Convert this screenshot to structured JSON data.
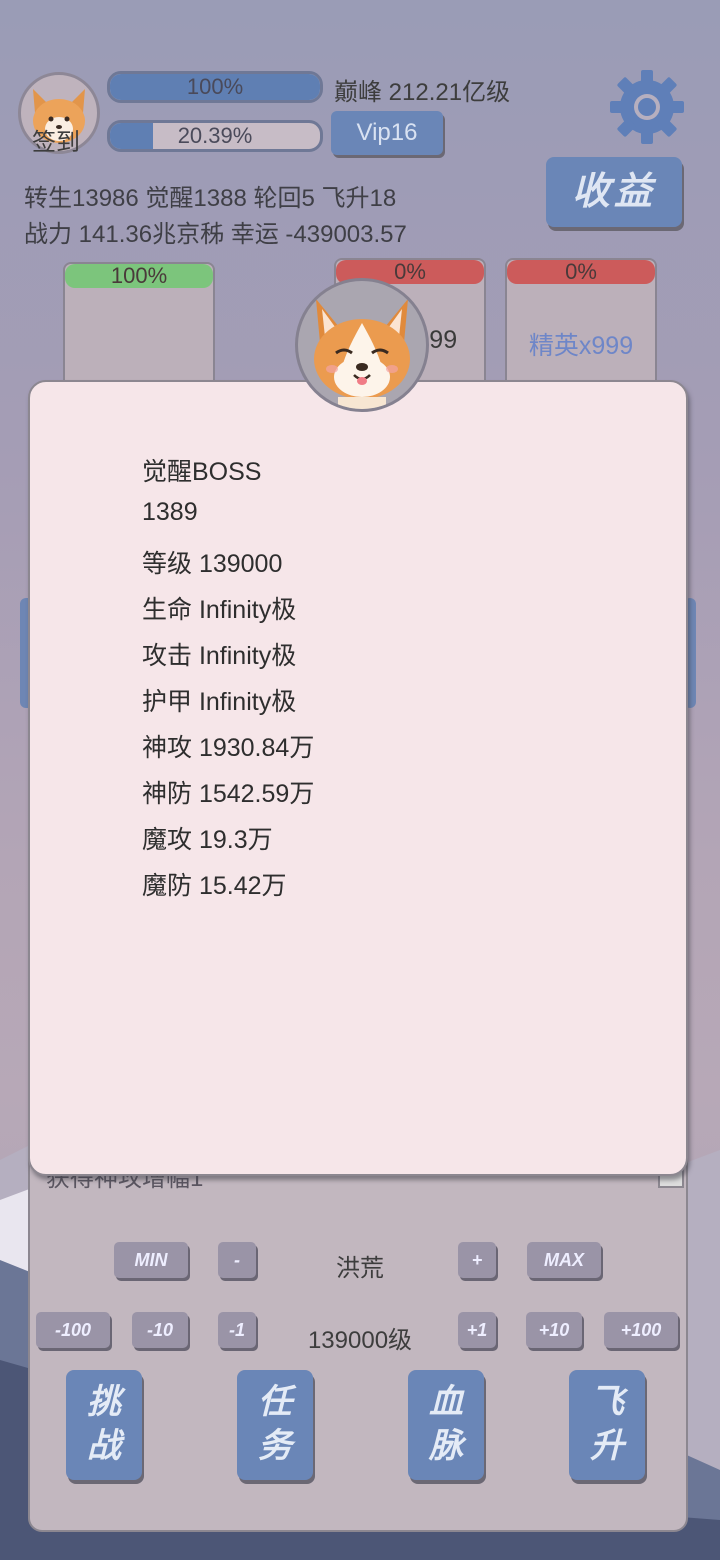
{
  "header": {
    "sign_in_label": "签到",
    "progress1": {
      "value": 1.0,
      "text": "100%"
    },
    "progress2": {
      "value": 0.2039,
      "text": "20.39%"
    },
    "realm_text": "巅峰 212.21亿级",
    "vip_label": "Vip16",
    "earnings_label": "收益",
    "settings_icon": "gear-icon"
  },
  "stats_lines": {
    "line1": "转生13986 觉醒1388 轮回5 飞升18",
    "line2": "战力 141.36兆京秭  幸运 -439003.57"
  },
  "cards": [
    {
      "bar_text": "100%",
      "bar_color": "#7cc57c",
      "label": ""
    },
    {
      "bar_text": "0%",
      "bar_color": "#cc5b5b",
      "label": "x999"
    },
    {
      "bar_text": "0%",
      "bar_color": "#cc5b5b",
      "label": "精英x999"
    }
  ],
  "modal": {
    "lines": [
      "觉醒BOSS",
      "1389",
      "等级 139000",
      "生命 Infinity极",
      "攻击 Infinity极",
      "护甲 Infinity极",
      "神攻 1930.84万",
      "神防 1542.59万",
      "魔攻 19.3万",
      "魔防 15.42万"
    ]
  },
  "panel": {
    "hidden_text": "获得神攻增幅1",
    "row1": {
      "min": "MIN",
      "minus": "-",
      "center": "洪荒",
      "plus": "+",
      "max": "MAX"
    },
    "row2": {
      "m100": "-100",
      "m10": "-10",
      "m1": "-1",
      "center": "139000级",
      "p1": "+1",
      "p10": "+10",
      "p100": "+100"
    },
    "actions": [
      {
        "line1": "挑",
        "line2": "战"
      },
      {
        "line1": "任",
        "line2": "务"
      },
      {
        "line1": "血",
        "line2": "脉"
      },
      {
        "line1": "飞",
        "line2": "升"
      }
    ]
  },
  "colors": {
    "accent": "#6a86b7",
    "modal_bg": "#f6e6e9",
    "panel_bg": "#c2b7bf"
  }
}
